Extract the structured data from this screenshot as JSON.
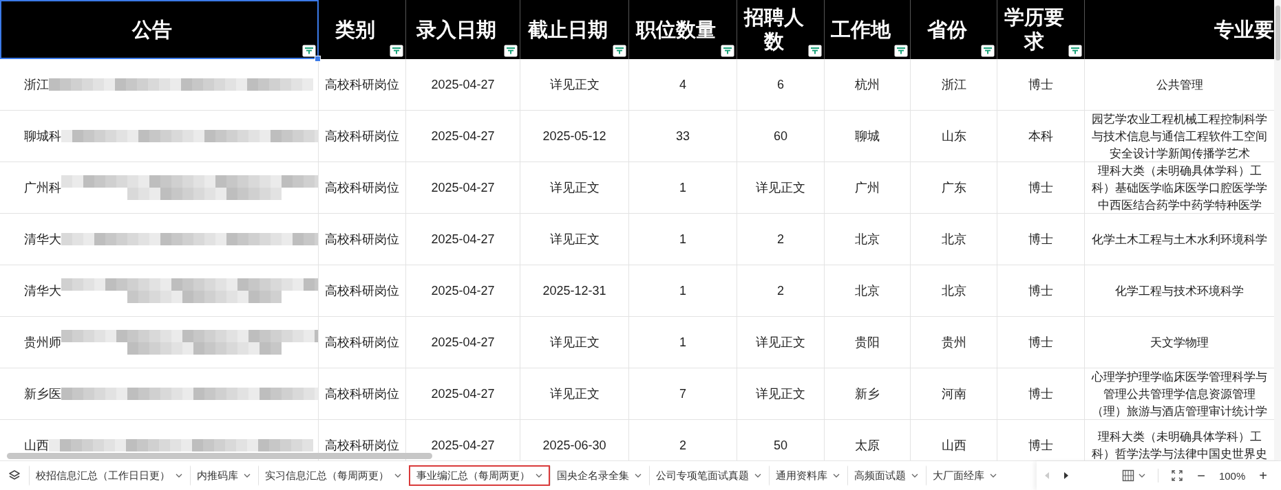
{
  "table": {
    "columns": [
      {
        "label": "公告",
        "selected": true
      },
      {
        "label": "类别",
        "selected": false
      },
      {
        "label": "录入日期",
        "selected": false
      },
      {
        "label": "截止日期",
        "selected": false
      },
      {
        "label": "职位数量",
        "selected": false
      },
      {
        "label": "招聘人数",
        "selected": false
      },
      {
        "label": "工作地",
        "selected": false
      },
      {
        "label": "省份",
        "selected": false
      },
      {
        "label": "学历要求",
        "selected": false
      },
      {
        "label": "专业要",
        "selected": false
      }
    ],
    "rows": [
      {
        "cells": [
          "浙江",
          "高校科研岗位",
          "2025-04-27",
          "详见正文",
          "4",
          "6",
          "杭州",
          "浙江",
          "博士",
          "公共管理"
        ]
      },
      {
        "cells": [
          "聊城科",
          "高校科研岗位",
          "2025-04-27",
          "2025-05-12",
          "33",
          "60",
          "聊城",
          "山东",
          "本科",
          "园艺学农业工程机械工程控制科学与技术信息与通信工程软件工空间安全设计学新闻传播学艺术"
        ]
      },
      {
        "cells": [
          "广州科",
          "高校科研岗位",
          "2025-04-27",
          "详见正文",
          "1",
          "详见正文",
          "广州",
          "广东",
          "博士",
          "理科大类（未明确具体学科）工科）基础医学临床医学口腔医学学中西医结合药学中药学特种医学"
        ]
      },
      {
        "cells": [
          "清华大",
          "高校科研岗位",
          "2025-04-27",
          "详见正文",
          "1",
          "2",
          "北京",
          "北京",
          "博士",
          "化学土木工程与土木水利环境科学"
        ]
      },
      {
        "cells": [
          "清华大",
          "高校科研岗位",
          "2025-04-27",
          "2025-12-31",
          "1",
          "2",
          "北京",
          "北京",
          "博士",
          "化学工程与技术环境科学"
        ]
      },
      {
        "cells": [
          "贵州师",
          "高校科研岗位",
          "2025-04-27",
          "详见正文",
          "1",
          "详见正文",
          "贵阳",
          "贵州",
          "博士",
          "天文学物理"
        ]
      },
      {
        "cells": [
          "新乡医",
          "高校科研岗位",
          "2025-04-27",
          "详见正文",
          "7",
          "详见正文",
          "新乡",
          "河南",
          "博士",
          "心理学护理学临床医学管理科学与管理公共管理学信息资源管理（理）旅游与酒店管理审计统计学"
        ]
      },
      {
        "cells": [
          "山西",
          "高校科研岗位",
          "2025-04-27",
          "2025-06-30",
          "2",
          "50",
          "太原",
          "山西",
          "博士",
          "理科大类（未明确具体学科）工科）哲学法学与法律中国史世界史"
        ]
      }
    ]
  },
  "sheet_tabs": [
    {
      "label": "校招信息汇总（工作日日更）",
      "selected": false
    },
    {
      "label": "内推码库",
      "selected": false
    },
    {
      "label": "实习信息汇总（每周两更）",
      "selected": false
    },
    {
      "label": "事业编汇总（每周两更）",
      "selected": true
    },
    {
      "label": "国央企名录全集",
      "selected": false
    },
    {
      "label": "公司专项笔面试真题",
      "selected": false
    },
    {
      "label": "通用资料库",
      "selected": false
    },
    {
      "label": "高频面试题",
      "selected": false
    },
    {
      "label": "大厂面经库",
      "selected": false
    }
  ],
  "zoom": {
    "minus": "−",
    "value": "100%",
    "plus": "+"
  }
}
